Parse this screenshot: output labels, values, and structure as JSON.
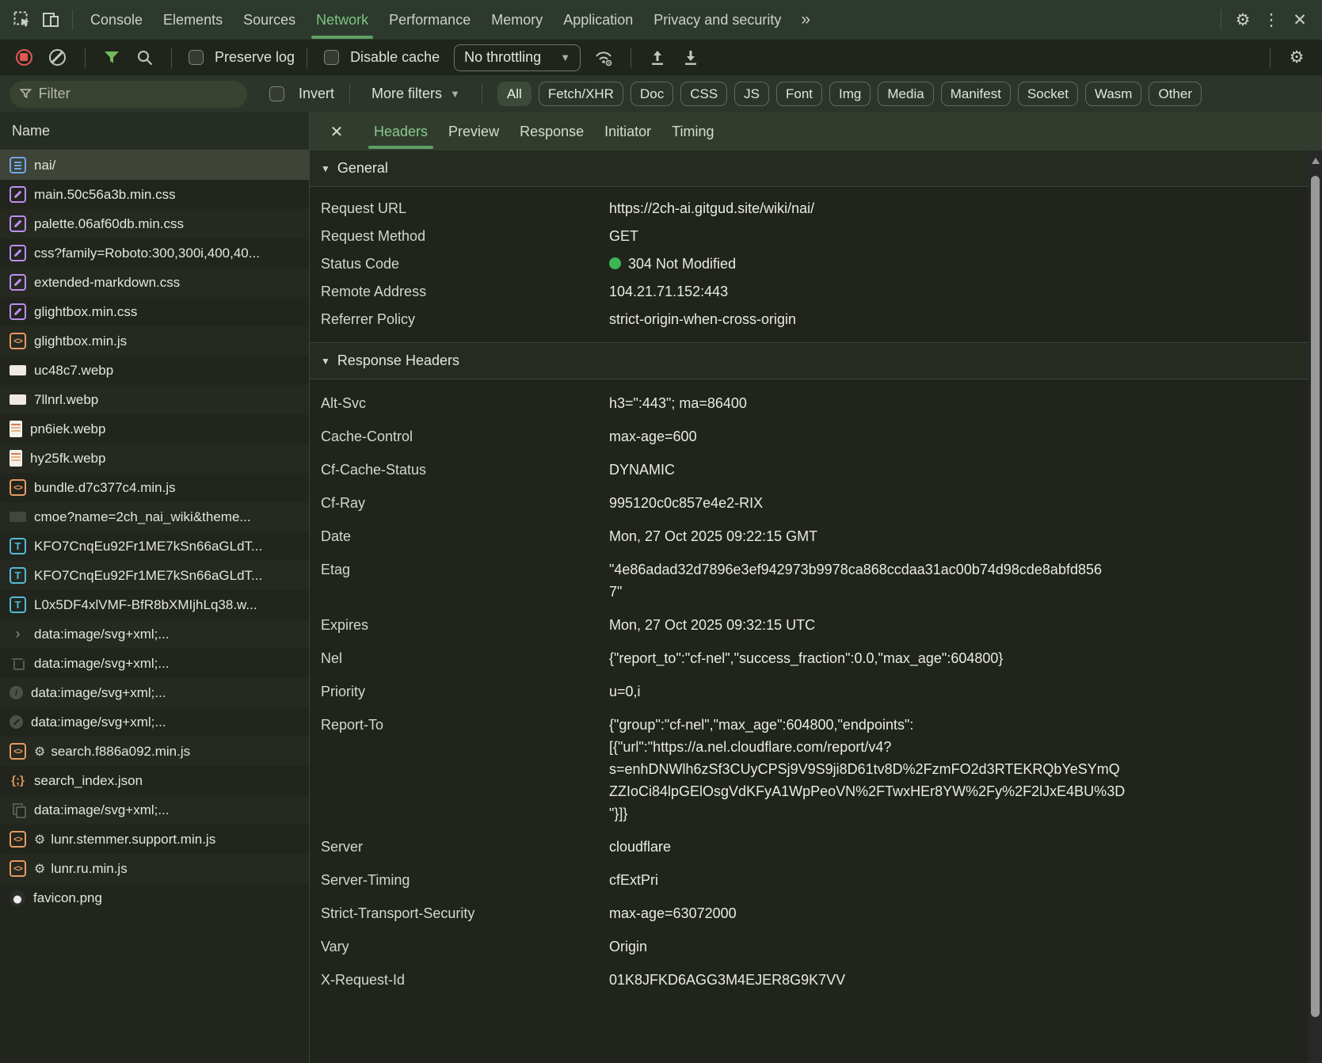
{
  "colors": {
    "accent_green": "#7cc581",
    "tab_underline_green": "#5f9f63",
    "status_green": "#3cb654",
    "record_red": "#e25752",
    "filter_funnel_green": "#74b95c",
    "icon_doc_blue": "#71a7e8",
    "icon_css_purple": "#bd8ef0",
    "icon_js_orange": "#e89a62",
    "icon_font_teal": "#53b9d8"
  },
  "main_toolbar": {
    "tabs": [
      "Console",
      "Elements",
      "Sources",
      "Network",
      "Performance",
      "Memory",
      "Application",
      "Privacy and security"
    ],
    "active_tab": "Network",
    "overflow_chevron": "»"
  },
  "network_toolbar": {
    "preserve_log_label": "Preserve log",
    "disable_cache_label": "Disable cache",
    "throttling_value": "No throttling",
    "throttling_caret": "▼"
  },
  "filter_bar": {
    "filter_placeholder": "Filter",
    "invert_label": "Invert",
    "more_filters_label": "More filters",
    "more_filters_caret": "▼",
    "type_filters": [
      "All",
      "Fetch/XHR",
      "Doc",
      "CSS",
      "JS",
      "Font",
      "Img",
      "Media",
      "Manifest",
      "Socket",
      "Wasm",
      "Other"
    ],
    "active_type_filter": "All"
  },
  "request_list": {
    "column_header": "Name",
    "rows": [
      {
        "name": "nai/",
        "icon": "doc",
        "selected": true
      },
      {
        "name": "main.50c56a3b.min.css",
        "icon": "css"
      },
      {
        "name": "palette.06af60db.min.css",
        "icon": "css"
      },
      {
        "name": "css?family=Roboto:300,300i,400,40...",
        "icon": "css"
      },
      {
        "name": "extended-markdown.css",
        "icon": "css"
      },
      {
        "name": "glightbox.min.css",
        "icon": "css"
      },
      {
        "name": "glightbox.min.js",
        "icon": "js"
      },
      {
        "name": "uc48c7.webp",
        "icon": "img-wide"
      },
      {
        "name": "7llnrl.webp",
        "icon": "img-wide"
      },
      {
        "name": "pn6iek.webp",
        "icon": "img-page"
      },
      {
        "name": "hy25fk.webp",
        "icon": "img-page"
      },
      {
        "name": "bundle.d7c377c4.min.js",
        "icon": "js"
      },
      {
        "name": "cmoe?name=2ch_nai_wiki&theme...",
        "icon": "img-dark"
      },
      {
        "name": "KFO7CnqEu92Fr1ME7kSn66aGLdT...",
        "icon": "font"
      },
      {
        "name": "KFO7CnqEu92Fr1ME7kSn66aGLdT...",
        "icon": "font"
      },
      {
        "name": "L0x5DF4xlVMF-BfR8bXMIjhLq38.w...",
        "icon": "font"
      },
      {
        "name": "data:image/svg+xml;...",
        "icon": "svg-chevron"
      },
      {
        "name": "data:image/svg+xml;...",
        "icon": "svg-trash"
      },
      {
        "name": "data:image/svg+xml;...",
        "icon": "svg-info"
      },
      {
        "name": "data:image/svg+xml;...",
        "icon": "svg-pencil"
      },
      {
        "name": "search.f886a092.min.js",
        "icon": "js",
        "gear": true
      },
      {
        "name": "search_index.json",
        "icon": "json"
      },
      {
        "name": "data:image/svg+xml;...",
        "icon": "svg-copy"
      },
      {
        "name": "lunr.stemmer.support.min.js",
        "icon": "js",
        "gear": true
      },
      {
        "name": "lunr.ru.min.js",
        "icon": "js",
        "gear": true
      },
      {
        "name": "favicon.png",
        "icon": "favicon"
      }
    ]
  },
  "detail_panel": {
    "tabs": [
      "Headers",
      "Preview",
      "Response",
      "Initiator",
      "Timing"
    ],
    "active_tab": "Headers",
    "close_label": "✕",
    "sections": [
      {
        "title": "General",
        "fields": [
          {
            "name": "Request URL",
            "value": "https://2ch-ai.gitgud.site/wiki/nai/"
          },
          {
            "name": "Request Method",
            "value": "GET"
          },
          {
            "name": "Status Code",
            "value": "304 Not Modified",
            "status_dot": true
          },
          {
            "name": "Remote Address",
            "value": "104.21.71.152:443"
          },
          {
            "name": "Referrer Policy",
            "value": "strict-origin-when-cross-origin"
          }
        ]
      },
      {
        "title": "Response Headers",
        "fields": [
          {
            "name": "Alt-Svc",
            "value": "h3=\":443\"; ma=86400"
          },
          {
            "name": "Cache-Control",
            "value": "max-age=600"
          },
          {
            "name": "Cf-Cache-Status",
            "value": "DYNAMIC"
          },
          {
            "name": "Cf-Ray",
            "value": "995120c0c857e4e2-RIX"
          },
          {
            "name": "Date",
            "value": "Mon, 27 Oct 2025 09:22:15 GMT"
          },
          {
            "name": "Etag",
            "value": "\"4e86adad32d7896e3ef942973b9978ca868ccdaa31ac00b74d98cde8abfd856\n7\""
          },
          {
            "name": "Expires",
            "value": "Mon, 27 Oct 2025 09:32:15 UTC"
          },
          {
            "name": "Nel",
            "value": "{\"report_to\":\"cf-nel\",\"success_fraction\":0.0,\"max_age\":604800}"
          },
          {
            "name": "Priority",
            "value": "u=0,i"
          },
          {
            "name": "Report-To",
            "value": "{\"group\":\"cf-nel\",\"max_age\":604800,\"endpoints\":\n[{\"url\":\"https://a.nel.cloudflare.com/report/v4?\ns=enhDNWlh6zSf3CUyCPSj9V9S9ji8D61tv8D%2FzmFO2d3RTEKRQbYeSYmQ\nZZIoCi84lpGElOsgVdKFyA1WpPeoVN%2FTwxHEr8YW%2Fy%2F2lJxE4BU%3D\n\"}]}"
          },
          {
            "name": "Server",
            "value": "cloudflare"
          },
          {
            "name": "Server-Timing",
            "value": "cfExtPri"
          },
          {
            "name": "Strict-Transport-Security",
            "value": "max-age=63072000"
          },
          {
            "name": "Vary",
            "value": "Origin"
          },
          {
            "name": "X-Request-Id",
            "value": "01K8JFKD6AGG3M4EJER8G9K7VV"
          }
        ]
      }
    ]
  }
}
